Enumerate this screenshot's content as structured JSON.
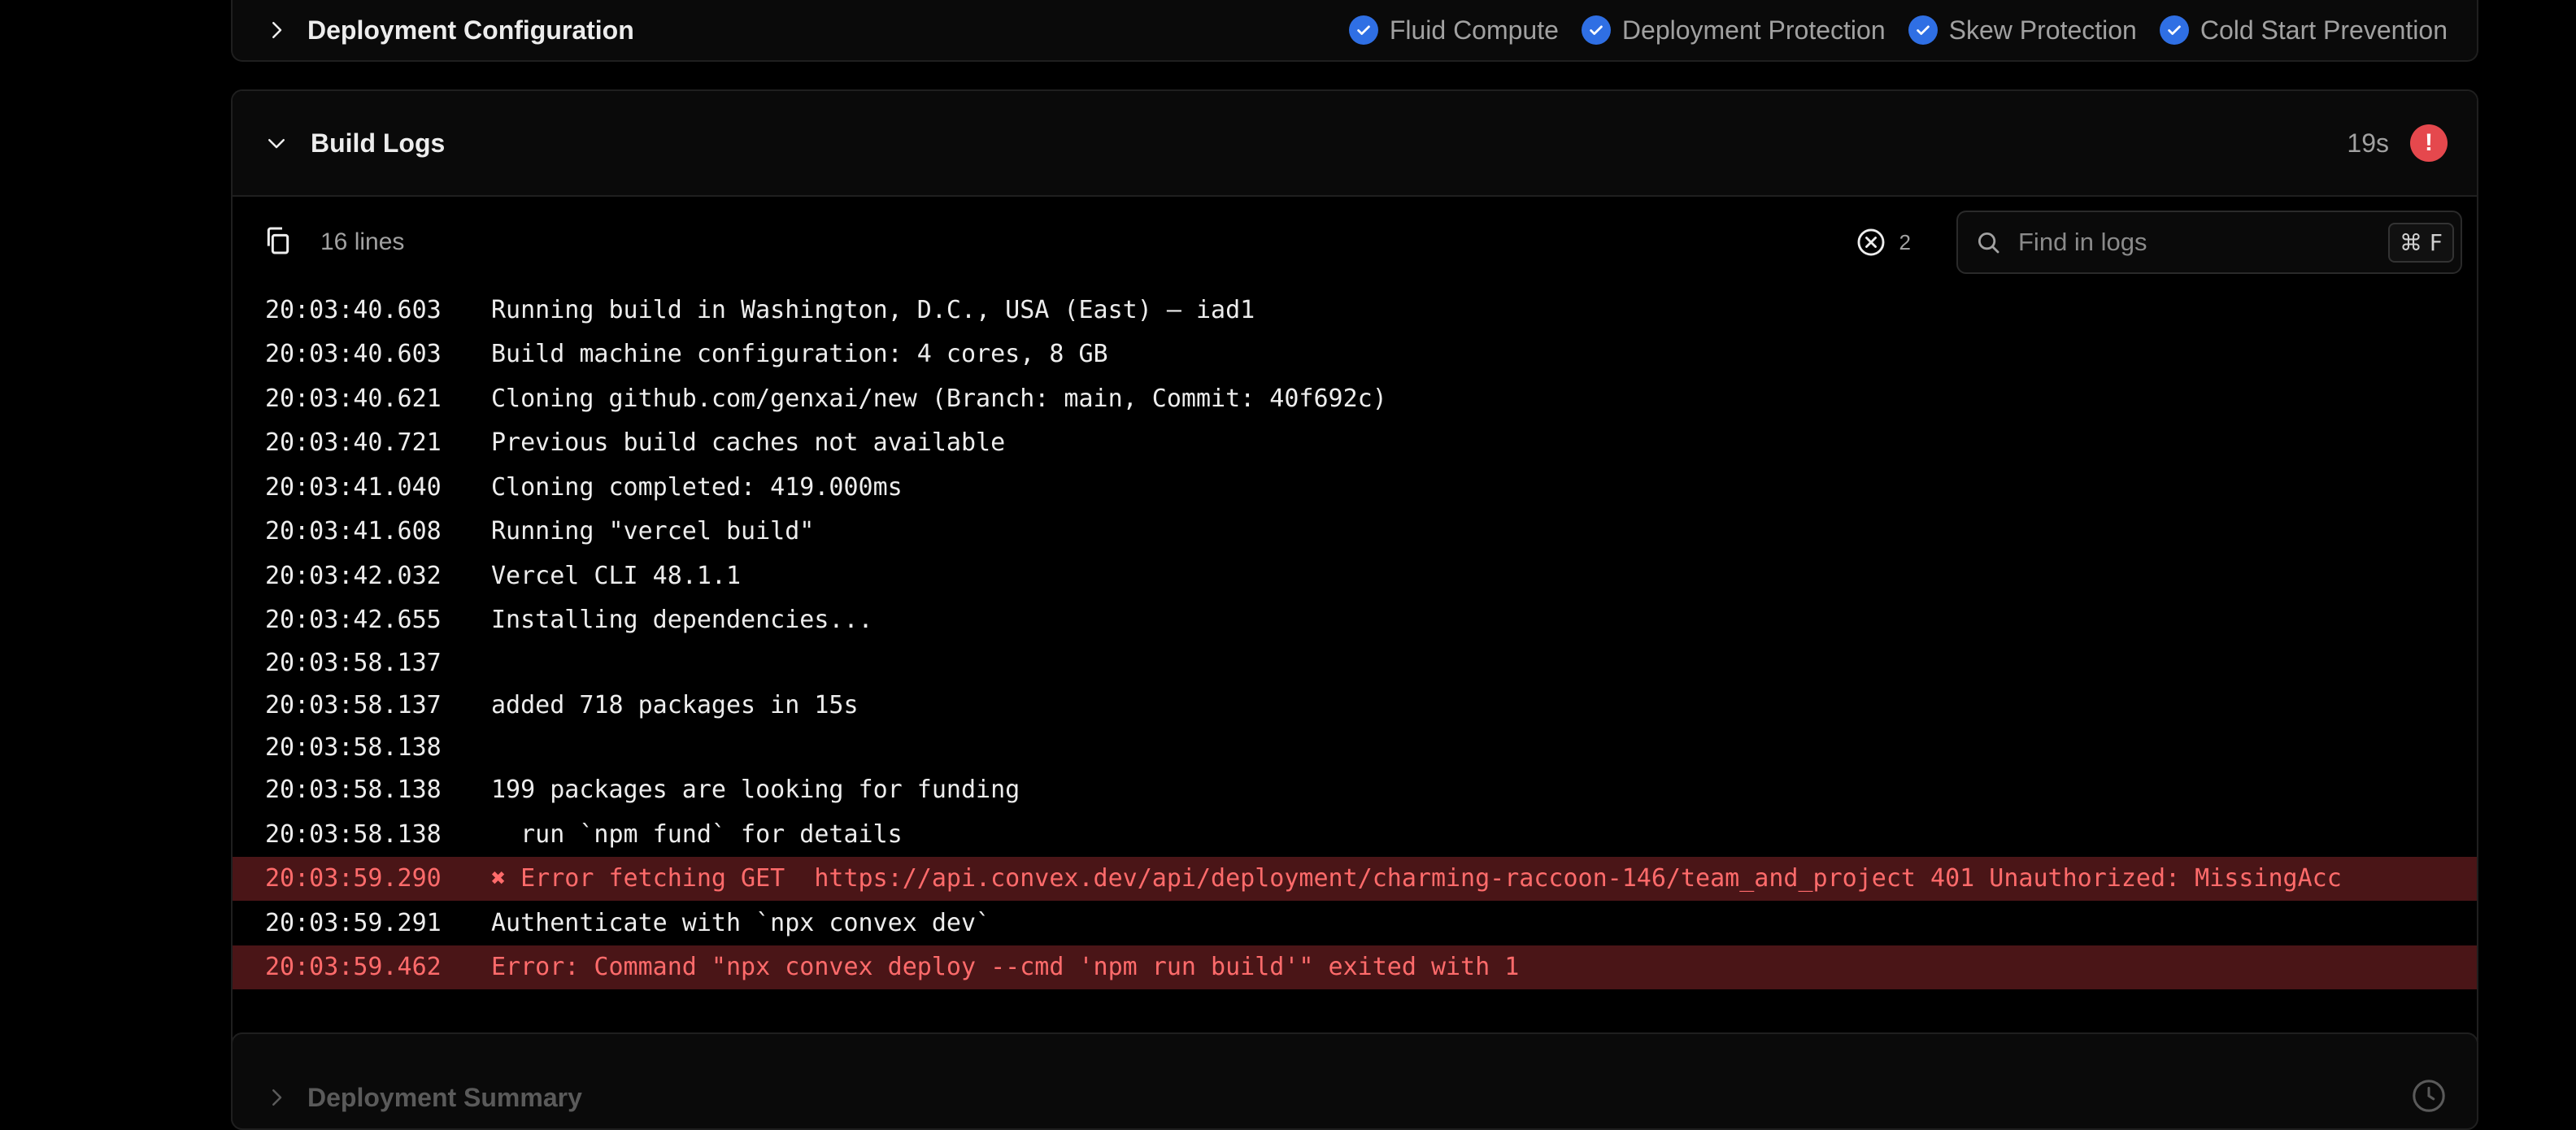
{
  "config": {
    "title": "Deployment Configuration",
    "features": [
      {
        "label": "Fluid Compute",
        "icon": "check-circle-icon"
      },
      {
        "label": "Deployment Protection",
        "icon": "check-circle-icon"
      },
      {
        "label": "Skew Protection",
        "icon": "check-circle-icon"
      },
      {
        "label": "Cold Start Prevention",
        "icon": "check-circle-icon"
      }
    ]
  },
  "build_logs": {
    "title": "Build Logs",
    "duration": "19s",
    "status_icon": "!",
    "lines_count": "16 lines",
    "error_count": "2",
    "search": {
      "placeholder": "Find in logs",
      "shortcut": "⌘ F"
    },
    "lines": [
      {
        "ts": "20:03:40.603",
        "msg": "Running build in Washington, D.C., USA (East) – iad1",
        "level": "info"
      },
      {
        "ts": "20:03:40.603",
        "msg": "Build machine configuration: 4 cores, 8 GB",
        "level": "info"
      },
      {
        "ts": "20:03:40.621",
        "msg": "Cloning github.com/genxai/new (Branch: main, Commit: 40f692c)",
        "level": "info"
      },
      {
        "ts": "20:03:40.721",
        "msg": "Previous build caches not available",
        "level": "info"
      },
      {
        "ts": "20:03:41.040",
        "msg": "Cloning completed: 419.000ms",
        "level": "info"
      },
      {
        "ts": "20:03:41.608",
        "msg": "Running \"vercel build\"",
        "level": "info"
      },
      {
        "ts": "20:03:42.032",
        "msg": "Vercel CLI 48.1.1",
        "level": "info"
      },
      {
        "ts": "20:03:42.655",
        "msg": "Installing dependencies...",
        "level": "info"
      },
      {
        "ts": "20:03:58.137",
        "msg": "",
        "level": "info"
      },
      {
        "ts": "20:03:58.137",
        "msg": "added 718 packages in 15s",
        "level": "info"
      },
      {
        "ts": "20:03:58.138",
        "msg": "",
        "level": "info"
      },
      {
        "ts": "20:03:58.138",
        "msg": "199 packages are looking for funding",
        "level": "info"
      },
      {
        "ts": "20:03:58.138",
        "msg": "  run `npm fund` for details",
        "level": "info"
      },
      {
        "ts": "20:03:59.290",
        "msg": "✖ Error fetching GET  https://api.convex.dev/api/deployment/charming-raccoon-146/team_and_project 401 Unauthorized: MissingAcc",
        "level": "error"
      },
      {
        "ts": "20:03:59.291",
        "msg": "Authenticate with `npx convex dev`",
        "level": "info"
      },
      {
        "ts": "20:03:59.462",
        "msg": "Error: Command \"npx convex deploy --cmd 'npm run build'\" exited with 1",
        "level": "error"
      }
    ]
  },
  "summary": {
    "title": "Deployment Summary"
  },
  "colors": {
    "accent": "#2f6fe4",
    "error": "#e5484d",
    "error_row_bg": "#4a1517",
    "error_text": "#ff6b6b"
  }
}
